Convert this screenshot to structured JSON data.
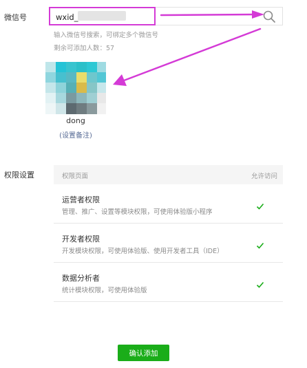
{
  "account": {
    "label": "微信号",
    "input_value": "wxid_",
    "hint": "输入微信号搜索，可绑定多个微信号",
    "remaining": "剩余可添加人数：57"
  },
  "user": {
    "nickname": "dong",
    "remark_link": "(设置备注)"
  },
  "permissions": {
    "label": "权限设置",
    "header_page": "权限页面",
    "header_allow": "允许访问",
    "rows": [
      {
        "title": "运营者权限",
        "desc": "管理、推广、设置等模块权限，可使用体验版小程序",
        "checked": true
      },
      {
        "title": "开发者权限",
        "desc": "开发模块权限，可使用体验版、使用开发者工具（IDE）",
        "checked": true
      },
      {
        "title": "数据分析者",
        "desc": "统计模块权限，可使用体验版",
        "checked": true
      }
    ]
  },
  "footer": {
    "confirm_label": "确认添加"
  },
  "colors": {
    "annotation": "#d43ad6",
    "primary_button": "#1aad19",
    "link": "#576b95",
    "check": "#1aad19"
  },
  "icons": {
    "search": "magnifier-icon",
    "check": "checkmark-icon"
  }
}
